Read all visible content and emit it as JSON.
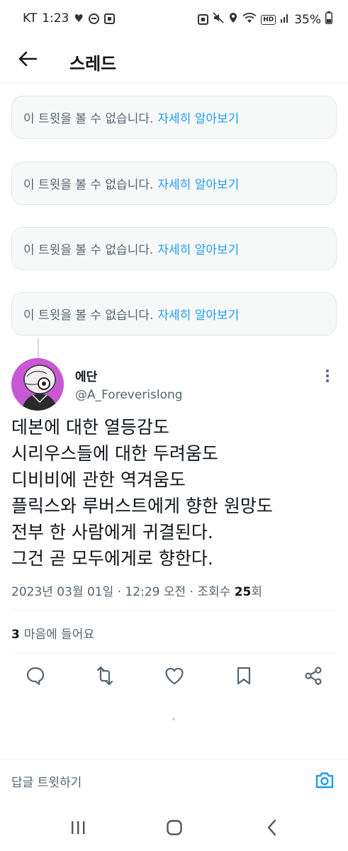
{
  "status_bar": {
    "carrier": "KT",
    "time": "1:23",
    "battery": "35%",
    "icons": [
      "heart-icon",
      "do-not-disturb-icon",
      "app-notification-icon",
      "camera-notification-icon",
      "mute-icon",
      "location-icon",
      "wifi-icon",
      "hd-voice-icon",
      "signal-icon"
    ],
    "hd_label": "HD"
  },
  "header": {
    "title": "스레드",
    "back_icon": "arrow-left-icon"
  },
  "unavailable_tweets": [
    {
      "message": "이 트윗을 볼 수 없습니다.",
      "link": "자세히 알아보기"
    },
    {
      "message": "이 트윗을 볼 수 없습니다.",
      "link": "자세히 알아보기"
    },
    {
      "message": "이 트윗을 볼 수 없습니다.",
      "link": "자세히 알아보기"
    },
    {
      "message": "이 트윗을 볼 수 없습니다.",
      "link": "자세히 알아보기"
    }
  ],
  "tweet": {
    "author_name": "에단",
    "author_handle": "@A_Foreverislong",
    "text_lines": [
      "데본에 대한 열등감도",
      "시리우스들에 대한 두려움도",
      "디비비에 관한 역겨움도",
      "플릭스와 루버스트에게 향한 원망도",
      "전부 한 사람에게 귀결된다.",
      "그건 곧 모두에게로 향한다."
    ],
    "meta_prefix": "2023년 03월 01일 · 12:29 오전 · 조회수 ",
    "views": "25",
    "views_suffix": "회",
    "likes_count": "3",
    "likes_label": "마음에 들어요",
    "actions": [
      "reply-icon",
      "retweet-icon",
      "like-icon",
      "bookmark-icon",
      "share-icon"
    ]
  },
  "reply_bar": {
    "placeholder": "답글 트윗하기",
    "camera_icon": "camera-icon"
  },
  "nav_bar": {
    "icons": [
      "recent-apps-icon",
      "home-icon",
      "back-icon"
    ]
  },
  "colors": {
    "accent": "#1d9bf0",
    "text_primary": "#0f1419",
    "text_secondary": "#536471",
    "box_bg": "#f7f9f9",
    "border": "#eff3f4"
  }
}
